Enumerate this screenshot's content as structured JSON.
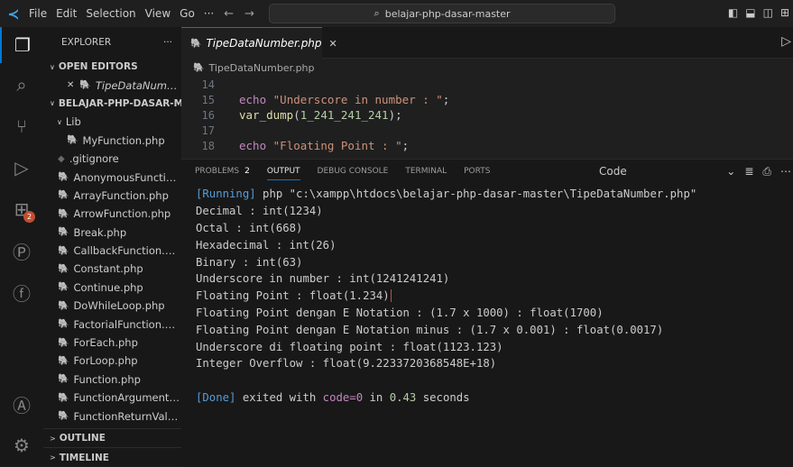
{
  "titlebar": {
    "menu": [
      "File",
      "Edit",
      "Selection",
      "View",
      "Go",
      "···"
    ],
    "nav_back": "←",
    "nav_forward": "→",
    "search_text": "belajar-php-dasar-master",
    "layout_icons": [
      "panel-left-icon",
      "panel-bottom-icon",
      "panel-right-icon",
      "layout-icon"
    ]
  },
  "activity": {
    "badge": "2",
    "icons": [
      "files-icon",
      "search-icon",
      "source-control-icon",
      "run-debug-icon",
      "extensions-icon",
      "php-icon",
      "lightning-icon",
      "account-icon",
      "settings-icon"
    ]
  },
  "sidebar": {
    "header": "EXPLORER",
    "header_more": "···",
    "open_editors_title": "OPEN EDITORS",
    "open_editor": {
      "close": "✕",
      "name": "TipeDataNumbe..."
    },
    "project_title": "BELAJAR-PHP-DASAR-MA...",
    "folder": "Lib",
    "lib_files": [
      "MyFunction.php"
    ],
    "gitignore": ".gitignore",
    "files": [
      "AnonymousFunction....",
      "ArrayFunction.php",
      "ArrowFunction.php",
      "Break.php",
      "CallbackFunction.php",
      "Constant.php",
      "Continue.php",
      "DoWhileLoop.php",
      "FactorialFunction.php",
      "ForEach.php",
      "ForLoop.php",
      "Function.php",
      "FunctionArgument.php",
      "FunctionReturnValue..."
    ],
    "outline": "OUTLINE",
    "timeline": "TIMELINE"
  },
  "tabs": {
    "active": "TipeDataNumber.php",
    "close": "✕"
  },
  "breadcrumb": "TipeDataNumber.php",
  "editor": {
    "lines": [
      {
        "n": "14",
        "parts": []
      },
      {
        "n": "15",
        "parts": [
          {
            "t": "echo ",
            "c": "kw"
          },
          {
            "t": "\"Underscore in number : \"",
            "c": "str"
          },
          {
            "t": ";",
            "c": "punc"
          }
        ]
      },
      {
        "n": "16",
        "parts": [
          {
            "t": "var_dump",
            "c": "fn"
          },
          {
            "t": "(",
            "c": "punc"
          },
          {
            "t": "1_241_241_241",
            "c": "num"
          },
          {
            "t": ");",
            "c": "punc"
          }
        ]
      },
      {
        "n": "17",
        "parts": []
      },
      {
        "n": "18",
        "parts": [
          {
            "t": "echo ",
            "c": "kw"
          },
          {
            "t": "\"Floating Point : \"",
            "c": "str"
          },
          {
            "t": ";",
            "c": "punc"
          }
        ]
      }
    ]
  },
  "panel": {
    "tabs": [
      "PROBLEMS",
      "OUTPUT",
      "DEBUG CONSOLE",
      "TERMINAL",
      "PORTS"
    ],
    "problems_count": "2",
    "active_tab": "OUTPUT",
    "channel": "Code",
    "channel_chevron": "⌄",
    "output": {
      "running_tag": "[Running]",
      "running_cmd": " php \"c:\\xampp\\htdocs\\belajar-php-dasar-master\\TipeDataNumber.php\"",
      "lines": [
        "Decimal : int(1234)",
        "Octal : int(668)",
        "Hexadecimal : int(26)",
        "Binary : int(63)",
        "Underscore in number : int(1241241241)",
        "Floating Point : float(1.234)",
        "Floating Point dengan E Notation : (1.7 x 1000) : float(1700)",
        "Floating Point dengan E Notation minus : (1.7 x 0.001) : float(0.0017)",
        "Underscore di floating point : float(1123.123)",
        "Integer Overflow : float(9.2233720368548E+18)"
      ],
      "done_tag": "[Done]",
      "done_text1": " exited with ",
      "done_code": "code=0",
      "done_text2": " in ",
      "done_time": "0.43",
      "done_text3": " seconds"
    }
  }
}
